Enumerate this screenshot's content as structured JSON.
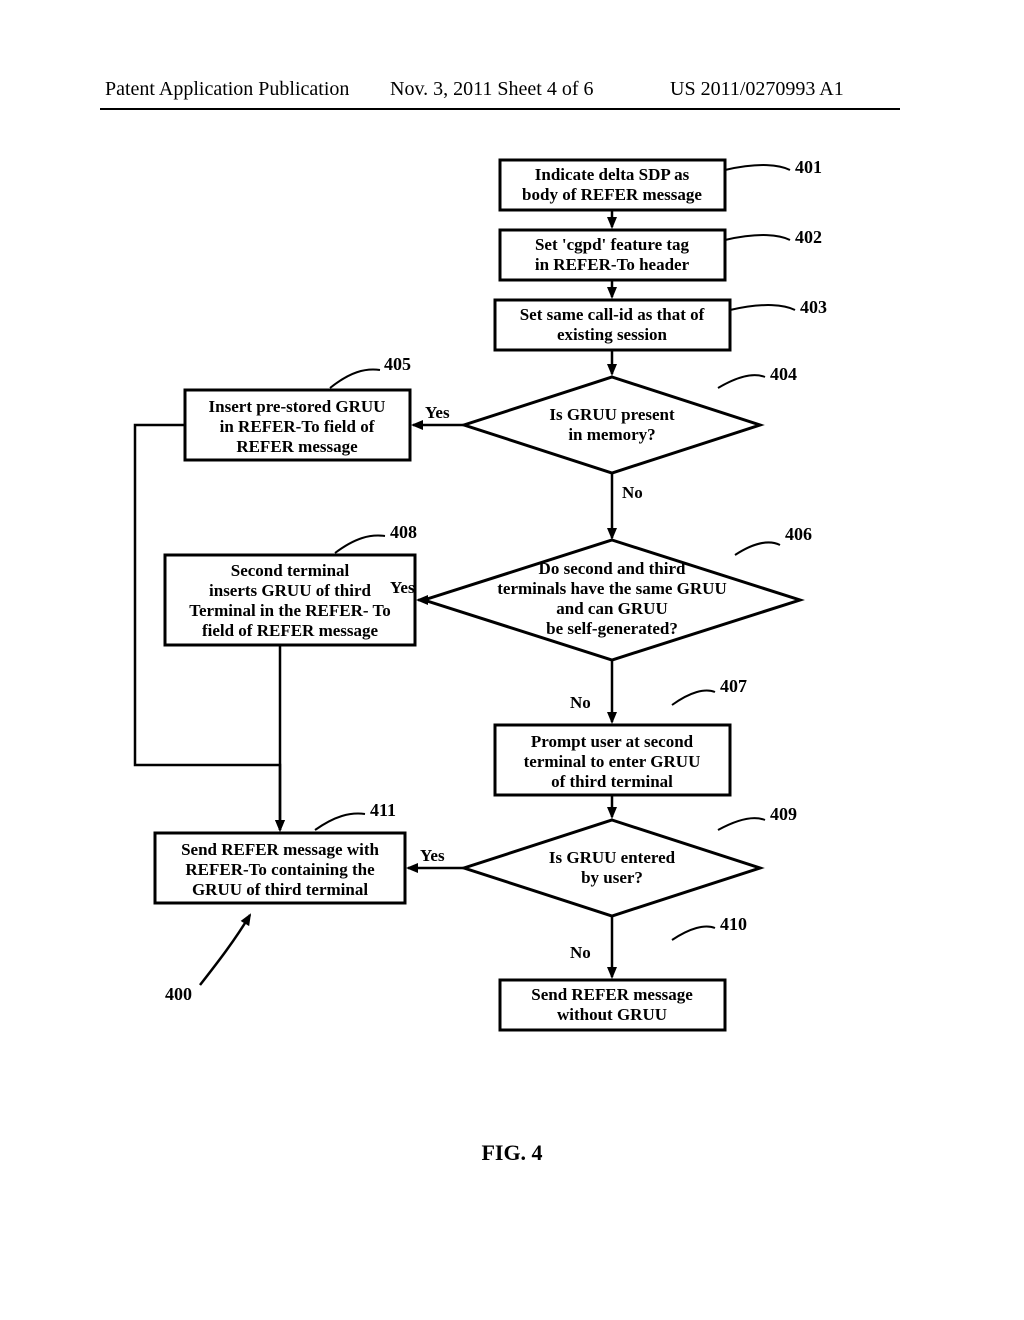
{
  "header": {
    "left": "Patent Application Publication",
    "center": "Nov. 3, 2011   Sheet 4 of 6",
    "right": "US 2011/0270993 A1"
  },
  "figure_label": "FIG. 4",
  "refs": {
    "r401": "401",
    "r402": "402",
    "r403": "403",
    "r404": "404",
    "r405": "405",
    "r406": "406",
    "r407": "407",
    "r408": "408",
    "r409": "409",
    "r410": "410",
    "r411": "411",
    "r400": "400"
  },
  "nodes": {
    "n401a": "Indicate delta SDP as",
    "n401b": "body of REFER message",
    "n402a": "Set 'cgpd' feature tag",
    "n402b": "in REFER-To header",
    "n403a": "Set same call-id  as that of",
    "n403b": "existing session",
    "n404a": "Is GRUU present",
    "n404b": "in memory?",
    "n405a": "Insert pre-stored GRUU",
    "n405b": "in REFER-To field of",
    "n405c": "REFER message",
    "n406a": "Do second and third",
    "n406b": "terminals have the same GRUU",
    "n406c": "and can GRUU",
    "n406d": "be self-generated?",
    "n407a": "Prompt user at second",
    "n407b": "terminal to enter GRUU",
    "n407c": "of third terminal",
    "n408a": "Second terminal",
    "n408b": "inserts GRUU of third",
    "n408c": "Terminal in the REFER- To",
    "n408d": "field of REFER message",
    "n409a": "Is GRUU entered",
    "n409b": "by user?",
    "n410a": "Send REFER message",
    "n410b": "without GRUU",
    "n411a": "Send REFER message  with",
    "n411b": "REFER-To containing the",
    "n411c": "GRUU of third terminal"
  },
  "edges": {
    "yes": "Yes",
    "no": "No"
  }
}
